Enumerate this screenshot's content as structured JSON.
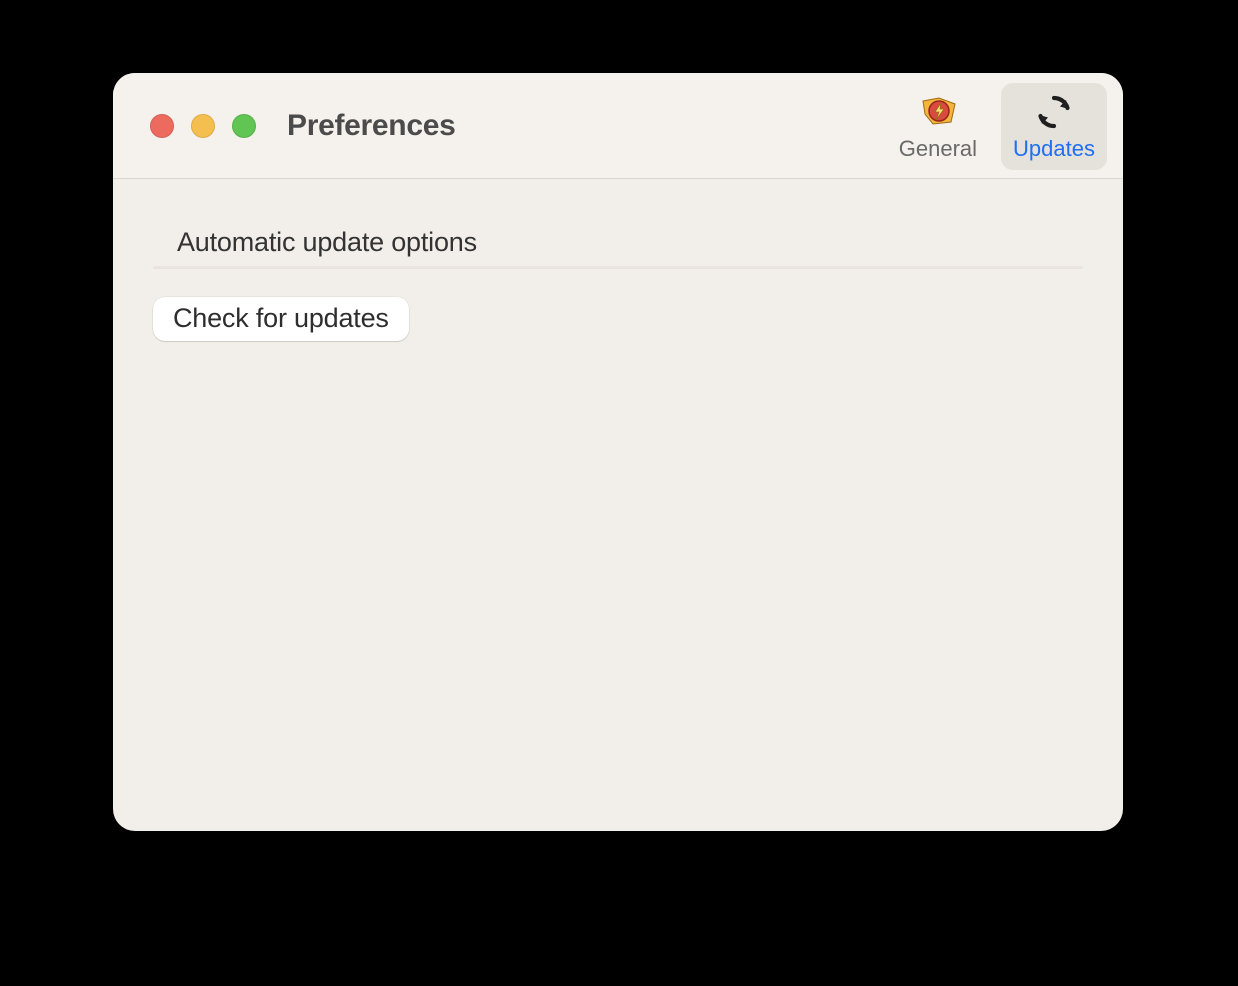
{
  "window": {
    "title": "Preferences"
  },
  "tabs": {
    "general": {
      "label": "General",
      "icon": "general-app-icon"
    },
    "updates": {
      "label": "Updates",
      "icon": "refresh-arrows-icon",
      "selected": true
    }
  },
  "content": {
    "section_title": "Automatic update options",
    "check_button_label": "Check for updates"
  },
  "colors": {
    "window_bg": "#f2eee9",
    "accent": "#1e6ff2",
    "close": "#ed6a5e",
    "minimize": "#f5bf4f",
    "zoom": "#61c554"
  }
}
